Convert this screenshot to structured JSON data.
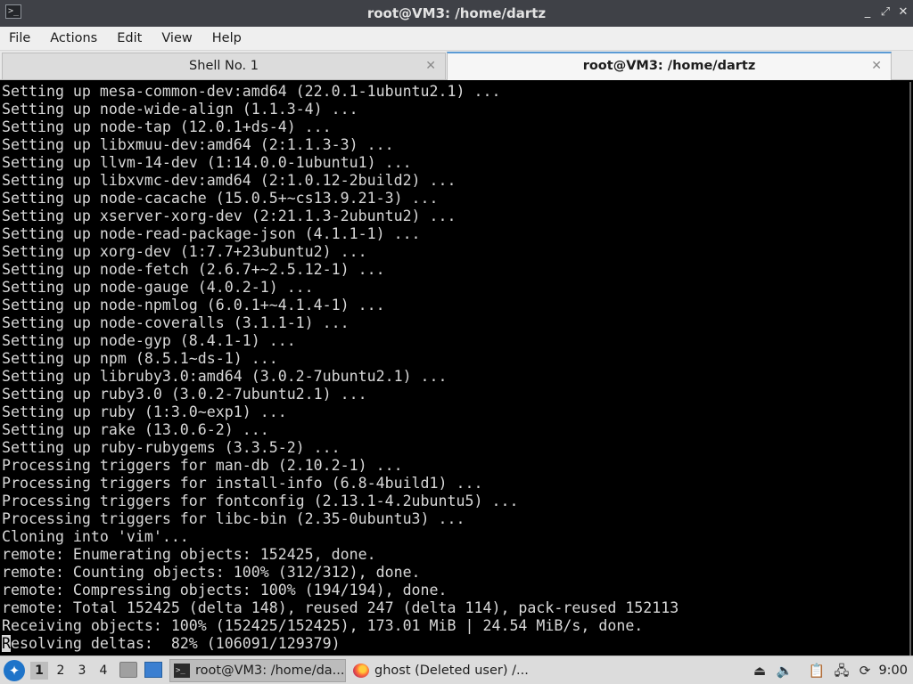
{
  "window": {
    "title": "root@VM3: /home/dartz",
    "icon": "terminal-icon",
    "controls": [
      "_",
      "⤢",
      "✕"
    ]
  },
  "menu": [
    "File",
    "Actions",
    "Edit",
    "View",
    "Help"
  ],
  "tabs": [
    {
      "label": "Shell No. 1",
      "active": false
    },
    {
      "label": "root@VM3: /home/dartz",
      "active": true
    }
  ],
  "terminal": {
    "lines": [
      "Setting up mesa-common-dev:amd64 (22.0.1-1ubuntu2.1) ...",
      "Setting up node-wide-align (1.1.3-4) ...",
      "Setting up node-tap (12.0.1+ds-4) ...",
      "Setting up libxmuu-dev:amd64 (2:1.1.3-3) ...",
      "Setting up llvm-14-dev (1:14.0.0-1ubuntu1) ...",
      "Setting up libxvmc-dev:amd64 (2:1.0.12-2build2) ...",
      "Setting up node-cacache (15.0.5+~cs13.9.21-3) ...",
      "Setting up xserver-xorg-dev (2:21.1.3-2ubuntu2) ...",
      "Setting up node-read-package-json (4.1.1-1) ...",
      "Setting up xorg-dev (1:7.7+23ubuntu2) ...",
      "Setting up node-fetch (2.6.7+~2.5.12-1) ...",
      "Setting up node-gauge (4.0.2-1) ...",
      "Setting up node-npmlog (6.0.1+~4.1.4-1) ...",
      "Setting up node-coveralls (3.1.1-1) ...",
      "Setting up node-gyp (8.4.1-1) ...",
      "Setting up npm (8.5.1~ds-1) ...",
      "Setting up libruby3.0:amd64 (3.0.2-7ubuntu2.1) ...",
      "Setting up ruby3.0 (3.0.2-7ubuntu2.1) ...",
      "Setting up ruby (1:3.0~exp1) ...",
      "Setting up rake (13.0.6-2) ...",
      "Setting up ruby-rubygems (3.3.5-2) ...",
      "Processing triggers for man-db (2.10.2-1) ...",
      "Processing triggers for install-info (6.8-4build1) ...",
      "Processing triggers for fontconfig (2.13.1-4.2ubuntu5) ...",
      "Processing triggers for libc-bin (2.35-0ubuntu3) ...",
      "Cloning into 'vim'...",
      "remote: Enumerating objects: 152425, done.",
      "remote: Counting objects: 100% (312/312), done.",
      "remote: Compressing objects: 100% (194/194), done.",
      "remote: Total 152425 (delta 148), reused 247 (delta 114), pack-reused 152113",
      "Receiving objects: 100% (152425/152425), 173.01 MiB | 24.54 MiB/s, done."
    ],
    "last_line_cursor_char": "R",
    "last_line_rest": "esolving deltas:  82% (106091/129379)"
  },
  "taskbar": {
    "start_icon": "start-menu-icon",
    "workspaces": [
      "1",
      "2",
      "3",
      "4"
    ],
    "current_workspace": "1",
    "tasks": [
      {
        "label": "root@VM3: /home/da...",
        "icon": "terminal-icon",
        "active": true
      },
      {
        "label": "ghost (Deleted user) /...",
        "icon": "firefox-icon",
        "active": false
      }
    ],
    "tray_icons": [
      "eject-icon",
      "volume-icon",
      "clipboard-icon",
      "network-icon",
      "update-icon"
    ],
    "clock": "9:00"
  }
}
